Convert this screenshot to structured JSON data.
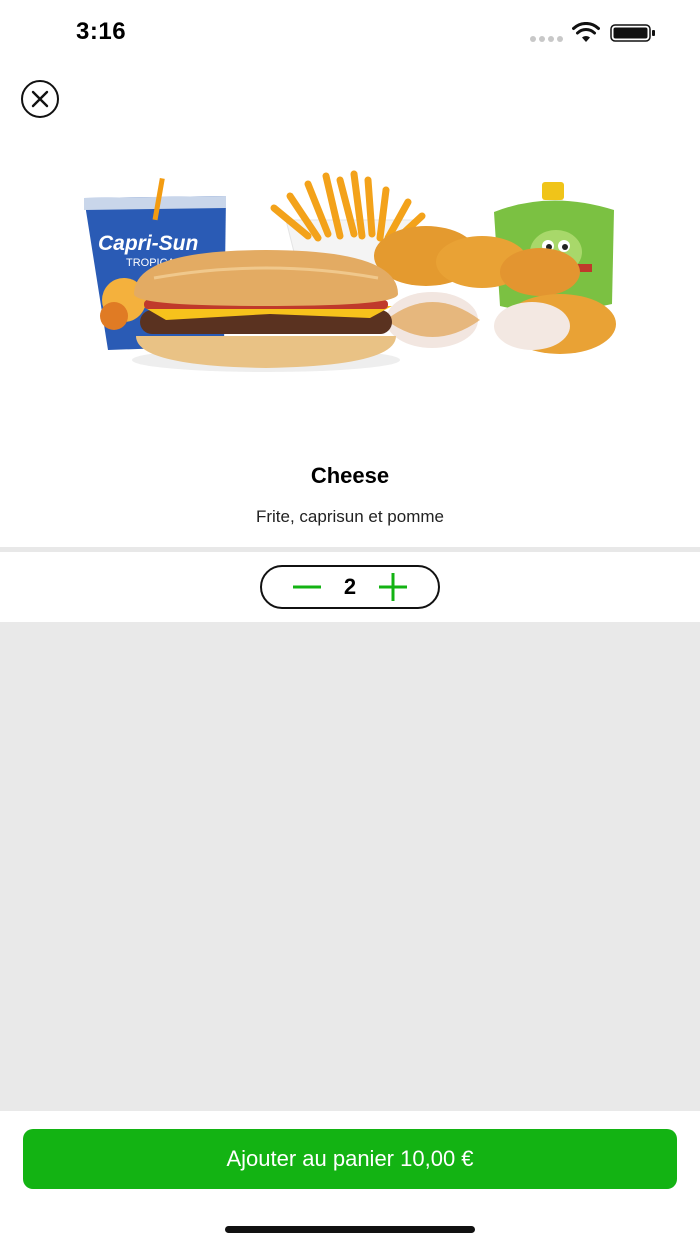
{
  "status_bar": {
    "time": "3:16"
  },
  "product": {
    "title": "Cheese",
    "description": "Frite, caprisun et pomme",
    "image_text": {
      "drink_brand": "Capri-Sun",
      "drink_flavor": "TROPICAL"
    }
  },
  "quantity": {
    "value": "2"
  },
  "cart_button": {
    "label": "Ajouter au panier 10,00 €"
  },
  "colors": {
    "accent_green": "#13b313",
    "content_bg": "#e9e9e9",
    "divider": "#e8e8e8"
  }
}
